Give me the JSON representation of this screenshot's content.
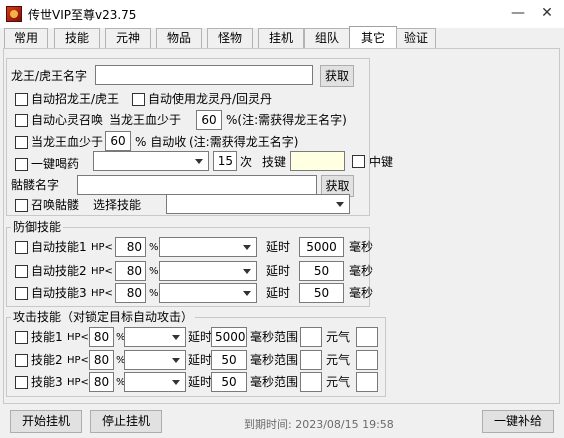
{
  "window": {
    "title": "传世VIP至尊v23.75"
  },
  "tabs": [
    "常用",
    "技能",
    "元神",
    "物品",
    "怪物",
    "挂机",
    "组队",
    "其它",
    "验证"
  ],
  "active_tab": "其它",
  "dragon": {
    "name_label": "龙王/虎王名字",
    "name_value": "",
    "get_label": "获取",
    "auto_summon_label": "自动招龙王/虎王",
    "auto_pill_label": "自动使用龙灵丹/回灵丹",
    "heart_label": "自动心灵召唤",
    "hp_less_label": "当龙王血少于",
    "hp_value": "60",
    "heart_note": "%(注:需获得龙王名字)",
    "auto_recall_prefix": "当龙王血少于",
    "recall_value": "60",
    "recall_suffix": "% 自动收",
    "recall_note": "(注:需获得龙王名字)"
  },
  "drink": {
    "label": "一键喝药",
    "select": "",
    "times_value": "15",
    "times_label": "次",
    "hotkey_label": "技键",
    "hotkey_value": "",
    "middle_key_label": "中键"
  },
  "skeleton": {
    "name_label": "骷髅名字",
    "name_value": "",
    "get_label": "获取",
    "summon_label": "召唤骷髅",
    "select_skill_label": "选择技能",
    "skill_select": ""
  },
  "defense": {
    "title": "防御技能",
    "rows": [
      {
        "label": "自动技能1",
        "hp_prefix": "HP<",
        "hp": "80",
        "percent": "%",
        "skill": "",
        "delay_label": "延时",
        "delay": "5000",
        "unit": "毫秒"
      },
      {
        "label": "自动技能2",
        "hp_prefix": "HP<",
        "hp": "80",
        "percent": "%",
        "skill": "",
        "delay_label": "延时",
        "delay": "50",
        "unit": "毫秒"
      },
      {
        "label": "自动技能3",
        "hp_prefix": "HP<",
        "hp": "80",
        "percent": "%",
        "skill": "",
        "delay_label": "延时",
        "delay": "50",
        "unit": "毫秒"
      }
    ]
  },
  "attack": {
    "title": "攻击技能（对锁定目标自动攻击）",
    "rows": [
      {
        "label": "技能1",
        "hp_prefix": "HP<",
        "hp": "80",
        "percent": "%",
        "skill": "",
        "delay_label": "延时",
        "delay": "5000",
        "range_label": "毫秒范围",
        "range": "",
        "qi_label": "元气",
        "qi": ""
      },
      {
        "label": "技能2",
        "hp_prefix": "HP<",
        "hp": "80",
        "percent": "%",
        "skill": "",
        "delay_label": "延时",
        "delay": "50",
        "range_label": "毫秒范围",
        "range": "",
        "qi_label": "元气",
        "qi": ""
      },
      {
        "label": "技能3",
        "hp_prefix": "HP<",
        "hp": "80",
        "percent": "%",
        "skill": "",
        "delay_label": "延时",
        "delay": "50",
        "range_label": "毫秒范围",
        "range": "",
        "qi_label": "元气",
        "qi": ""
      }
    ]
  },
  "footer": {
    "start_label": "开始挂机",
    "stop_label": "停止挂机",
    "expiry_text": "到期时间: 2023/08/15 19:58",
    "refill_label": "一键补给"
  }
}
